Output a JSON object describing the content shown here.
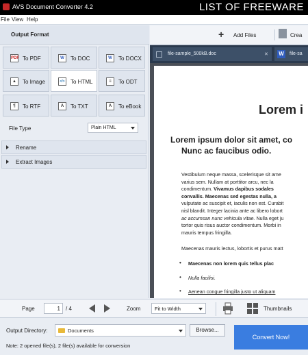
{
  "titlebar": {
    "title": "AVS Document Converter 4.2",
    "brand": "LIST OF FREEWARE"
  },
  "menu": [
    "File",
    "View",
    "Help"
  ],
  "left": {
    "header": "Output Format",
    "formats": [
      {
        "label": "To PDF",
        "icon": "pdf-icon",
        "glyph": "PDF"
      },
      {
        "label": "To DOC",
        "icon": "doc-icon",
        "glyph": "W"
      },
      {
        "label": "To DOCX",
        "icon": "docx-icon",
        "glyph": "W"
      },
      {
        "label": "To Image",
        "icon": "image-icon",
        "glyph": "▲"
      },
      {
        "label": "To HTML",
        "icon": "html-icon",
        "glyph": "</>"
      },
      {
        "label": "To ODT",
        "icon": "odt-icon",
        "glyph": "≡"
      },
      {
        "label": "To RTF",
        "icon": "rtf-icon",
        "glyph": "¶"
      },
      {
        "label": "To TXT",
        "icon": "txt-icon",
        "glyph": "A"
      },
      {
        "label": "To eBook",
        "icon": "ebook-icon",
        "glyph": "A"
      }
    ],
    "selected_format": "To HTML",
    "file_type_label": "File Type",
    "file_type_value": "Plain HTML",
    "rename_label": "Rename",
    "extract_label": "Extract Images"
  },
  "toolbar": {
    "add_files": "Add Files",
    "create": "Crea"
  },
  "tabs": [
    {
      "label": "file-sample_500kB.doc",
      "icon": "grid-icon"
    },
    {
      "label": "file-sa",
      "icon": "word-icon"
    }
  ],
  "document": {
    "title": "Lorem i",
    "heading_line1": "Lorem ipsum dolor sit amet, co",
    "heading_line2": "Nunc ac faucibus odio.",
    "para1_part1": "Vestibulum neque massa, scelerisque sit ame",
    "para1_part2": "varius sem. Nullam at porttitor arcu, nec la",
    "para1_part3": "condimentum. ",
    "para1_bold1": "Vivamus dapibus sodales",
    "para1_bold2": "convallis. Maecenas sed egestas nulla, a",
    "para1_part4": "vulputate ac suscipit et, iaculis non est. Curabit",
    "para1_part5": "nisl blandit. Integer lacinia ante ac libero lobort",
    "para1_italic": "ac accumsan nunc vehicula vitae.",
    "para1_part6": " Nulla eget ju",
    "para1_part7": "tortor quis risus auctor condimentum. Morbi in",
    "para1_part8": "mauris tempus fringilla.",
    "para2": "Maecenas mauris lectus, lobortis et purus matt",
    "bullets": [
      "Maecenas non lorem quis tellus plac",
      "Nulla facilisi.",
      "Aenean congue fringilla justo ut aliquam"
    ]
  },
  "bottombar": {
    "page_label": "Page",
    "page_value": "1",
    "page_total": "/ 4",
    "zoom_label": "Zoom",
    "zoom_value": "Fit to Width",
    "thumbnails": "Thumbnails"
  },
  "footer": {
    "output_dir_label": "Output Directory:",
    "output_dir_value": "Documents",
    "browse": "Browse...",
    "note": "Note: 2 opened file(s), 2 file(s) available for conversion",
    "convert": "Convert Now!"
  },
  "colors": {
    "accent": "#3a7de0",
    "titlebar": "#000000",
    "tabbar": "#2b3a4e"
  }
}
